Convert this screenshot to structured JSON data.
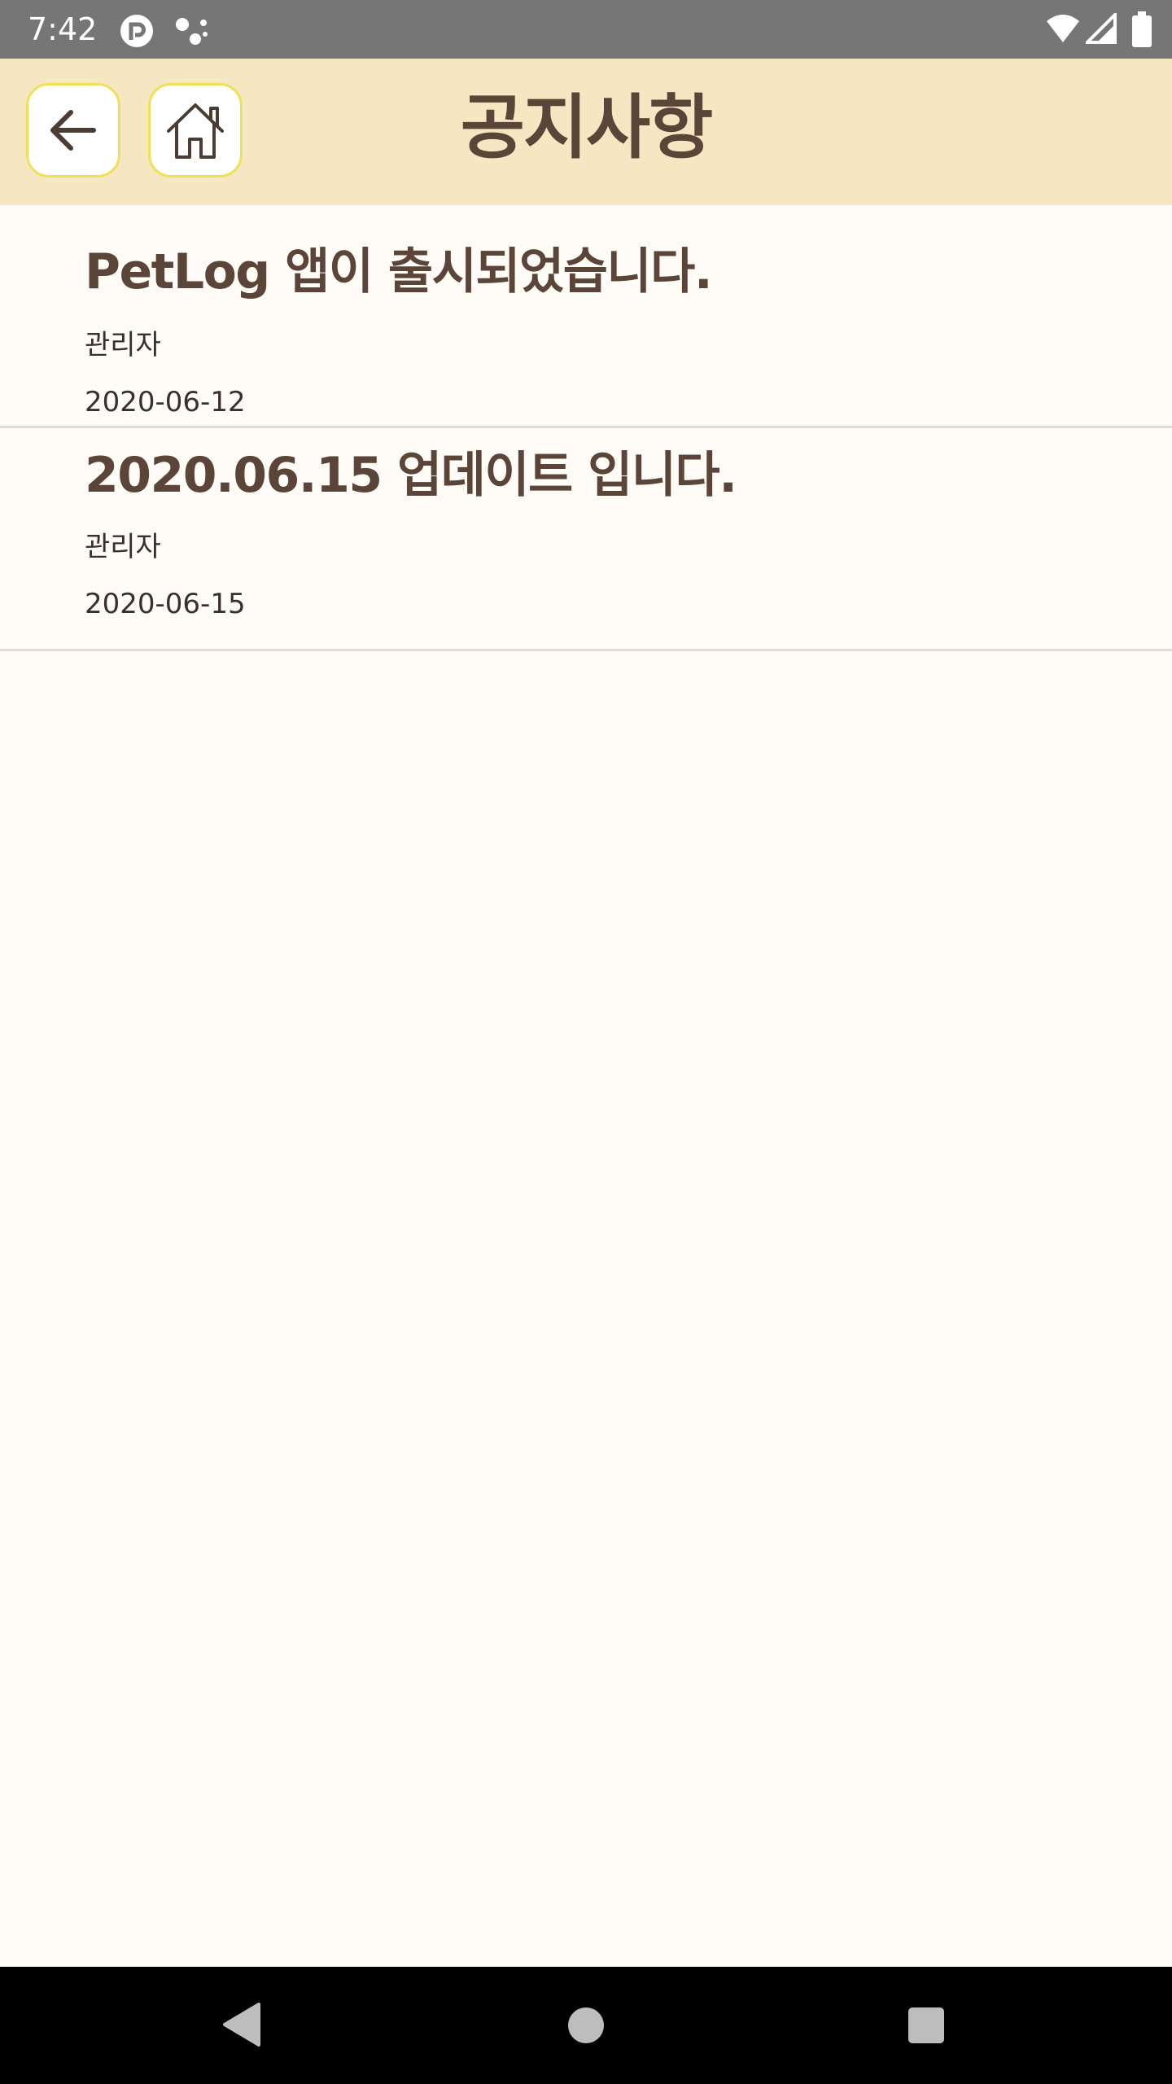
{
  "status_bar": {
    "time": "7:42"
  },
  "header": {
    "title": "공지사항",
    "back_icon": "arrow-left-icon",
    "home_icon": "home-icon",
    "accent_color": "#f5e7c2",
    "button_border_color": "#efe05a",
    "title_color": "#5b4538"
  },
  "notices": [
    {
      "title": "PetLog 앱이 출시되었습니다.",
      "author": "관리자",
      "date": "2020-06-12"
    },
    {
      "title": "2020.06.15 업데이트 입니다.",
      "author": "관리자",
      "date": "2020-06-15"
    }
  ],
  "system_nav": {
    "icons": [
      "back-triangle-icon",
      "home-circle-icon",
      "recents-square-icon"
    ]
  }
}
